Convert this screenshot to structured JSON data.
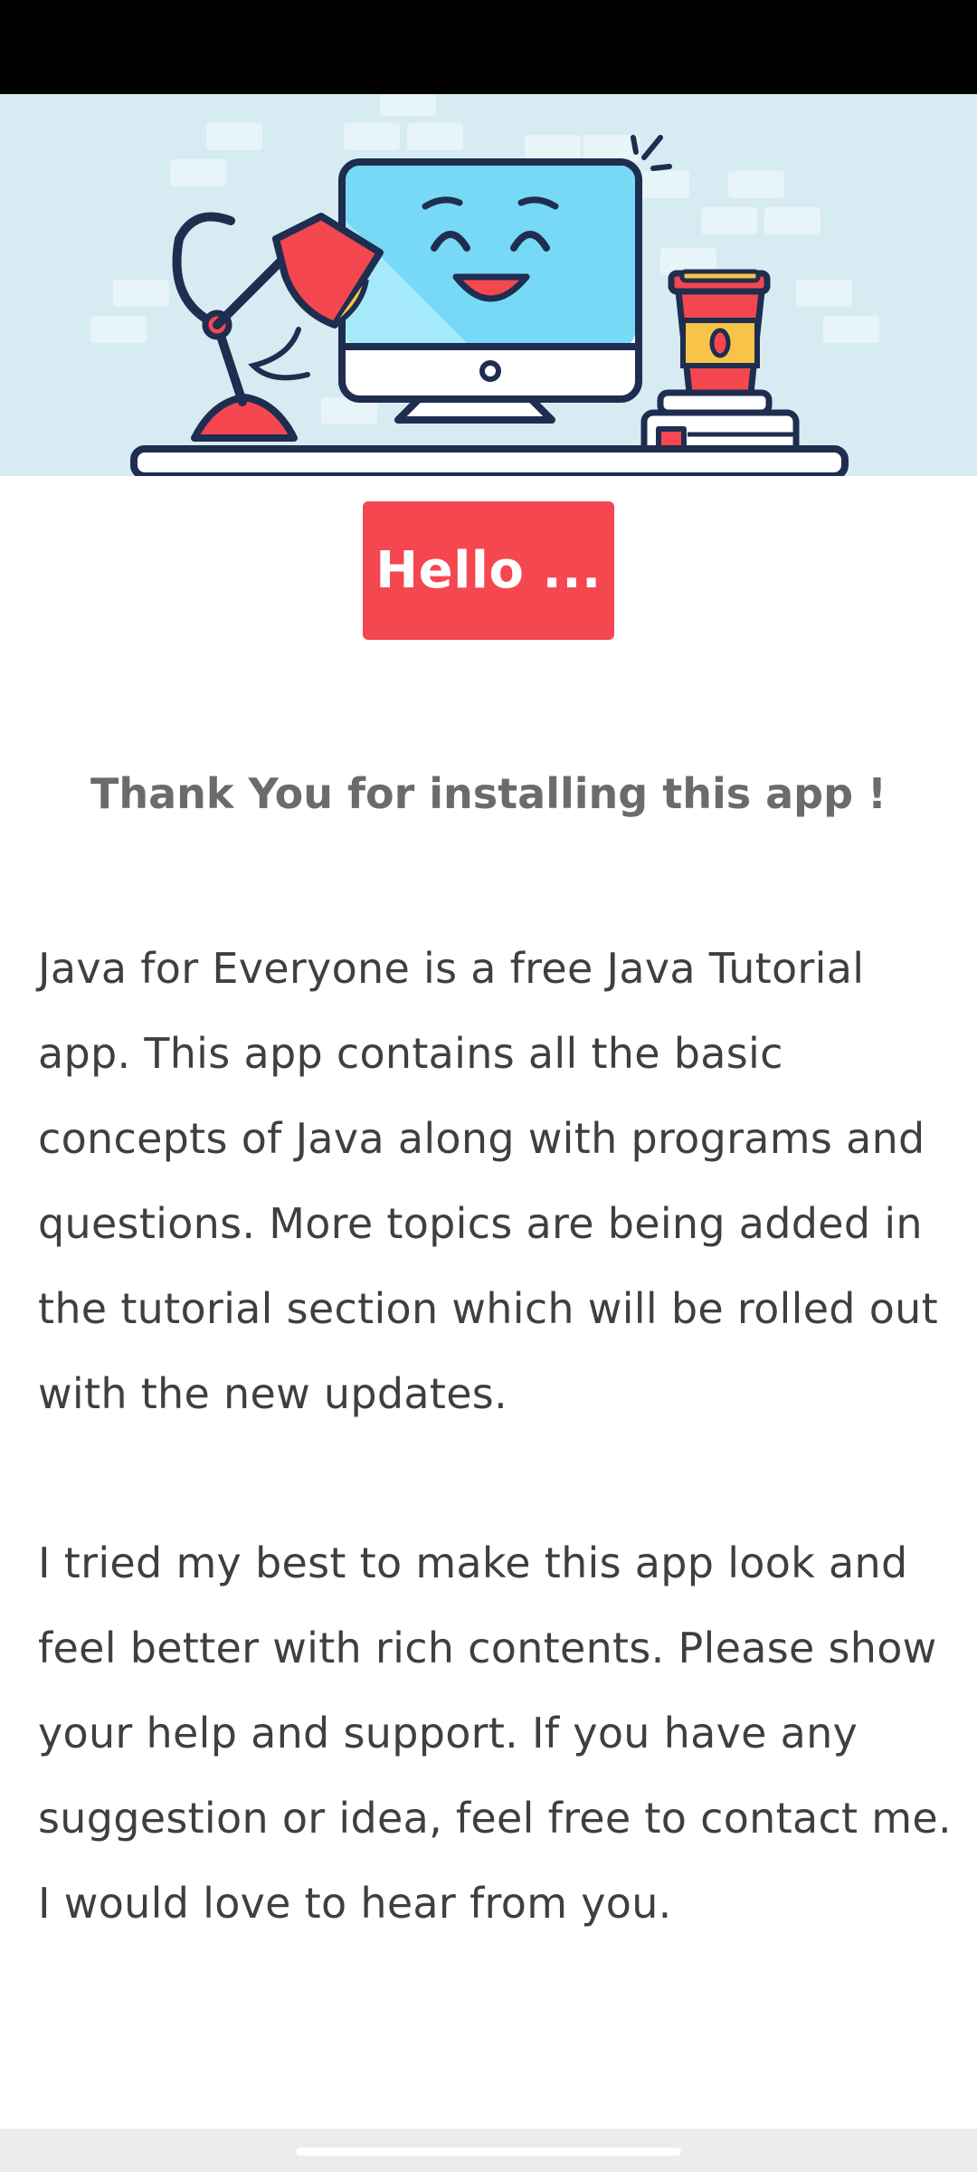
{
  "hero": {
    "illustration": "desk-computer-illustration",
    "colors": {
      "background": "#d7ecf2",
      "monitor_screen": "#76d9f5",
      "accent_red": "#f4474f",
      "accent_yellow": "#f8c447",
      "outline": "#1f2d50"
    }
  },
  "hello_button": {
    "label": "Hello ...",
    "color": "#f4474f"
  },
  "thanks": {
    "title": "Thank You for installing this app !"
  },
  "content": {
    "paragraph_1": "Java for Everyone is a free Java Tutorial app. This app contains all the basic concepts of Java along with programs and questions. More topics are being added in the tutorial section which will be rolled out with the new updates.",
    "paragraph_2": "I tried my best to make this app look and feel better with rich contents. Please show your help and support. If you have any suggestion or idea, feel free to contact me. I would love to hear from you."
  }
}
